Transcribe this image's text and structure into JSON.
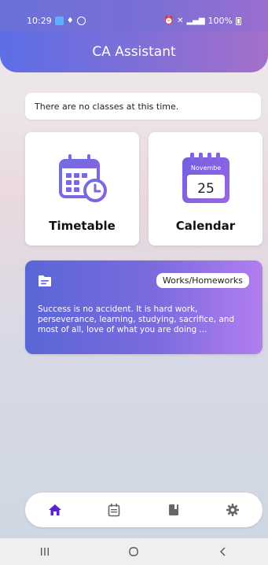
{
  "status": {
    "time": "10:29",
    "battery": "100%"
  },
  "header": {
    "title": "CA Assistant"
  },
  "notice": {
    "text": "There are no classes at this time."
  },
  "cards": {
    "timetable": {
      "label": "Timetable",
      "icon": "timetable-icon"
    },
    "calendar": {
      "label": "Calendar",
      "icon": "calendar-icon",
      "month": "Novembe",
      "day": "25"
    }
  },
  "homework": {
    "badge": "Works/Homeworks",
    "quote": "Success is no accident. It is hard work, perseverance, learning, studying, sacrifice, and most of all, love of what you are doing ...",
    "icon": "folder-icon"
  },
  "bottom_nav": {
    "items": [
      {
        "name": "home",
        "icon": "home-icon",
        "active": true
      },
      {
        "name": "timetable",
        "icon": "calendar-icon",
        "active": false
      },
      {
        "name": "notes",
        "icon": "book-icon",
        "active": false
      },
      {
        "name": "settings",
        "icon": "gear-icon",
        "active": false
      }
    ]
  },
  "colors": {
    "accent": "#6b2bd8",
    "header_start": "#5d6ee6",
    "header_end": "#a46fcb",
    "card_gradient_start": "#5a66d6",
    "card_gradient_end": "#b27ef0",
    "icon_purple": "#7a5fe0"
  }
}
